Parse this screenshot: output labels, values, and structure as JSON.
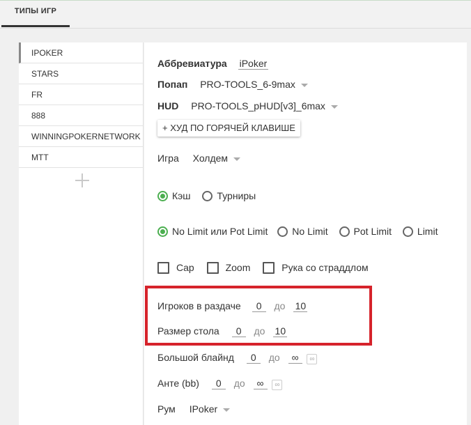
{
  "tabs": {
    "active_label": "ТИПЫ ИГР"
  },
  "game_types": {
    "items": [
      "IPOKER",
      "STARS",
      "FR",
      "888",
      "WINNINGPOKERNETWORK",
      "MTT"
    ],
    "active_index": 0
  },
  "form": {
    "abbrev_label": "Аббревиатура",
    "abbrev_value": "iPoker",
    "popup_label": "Попап",
    "popup_value": "PRO-TOOLS_6-9max",
    "hud_label": "HUD",
    "hud_value": "PRO-TOOLS_pHUD[v3]_6max",
    "hotkey_button": "+ ХУД ПО ГОРЯЧЕЙ КЛАВИШЕ",
    "game_label": "Игра",
    "game_value": "Холдем",
    "mode_options": [
      "Кэш",
      "Турниры"
    ],
    "mode_selected": "Кэш",
    "limit_options": [
      "No Limit или Pot Limit",
      "No Limit",
      "Pot Limit",
      "Limit"
    ],
    "limit_selected": "No Limit или Pot Limit",
    "checkboxes": [
      "Cap",
      "Zoom",
      "Рука со страддлом"
    ],
    "players_label": "Игроков в раздаче",
    "players_from": "0",
    "players_to_label": "до",
    "players_to": "10",
    "table_size_label": "Размер стола",
    "table_from": "0",
    "table_to_label": "до",
    "table_to": "10",
    "big_blind_label": "Большой блайнд",
    "big_blind_from": "0",
    "big_blind_to_label": "до",
    "big_blind_to": "∞",
    "ante_label": "Анте (bb)",
    "ante_from": "0",
    "ante_to_label": "до",
    "ante_to": "∞",
    "room_label": "Рум",
    "room_value": "IPoker"
  },
  "icons": {
    "infinity_toggle": "∞"
  },
  "colors": {
    "accent_green": "#4caf50",
    "highlight_red": "#d6232b"
  }
}
